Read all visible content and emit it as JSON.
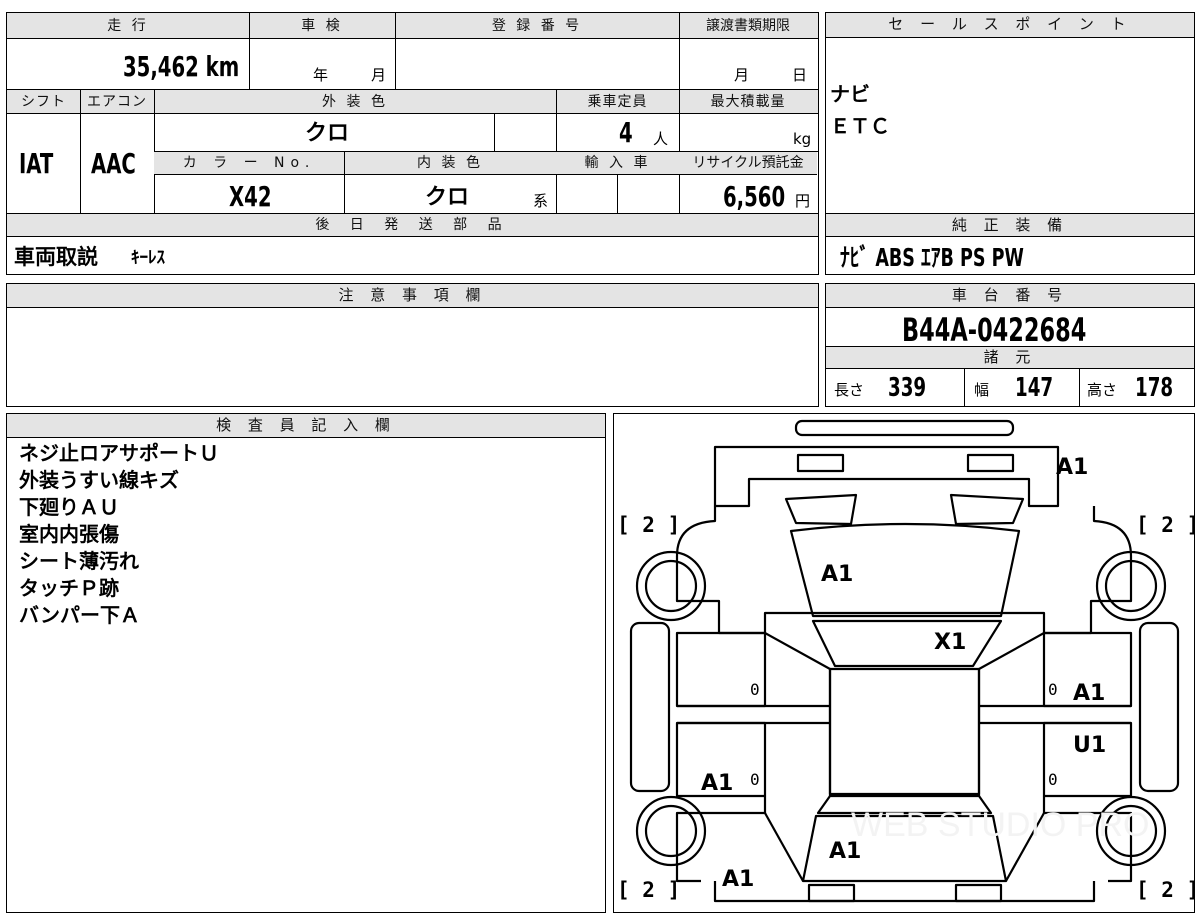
{
  "top_info": {
    "mileage_label": "走 行",
    "mileage": "35,462 km",
    "shaken_label": "車 検",
    "shaken_year": "年",
    "shaken_month": "月",
    "registration_label": "登 録 番 号",
    "transfer_deadline_label": "譲渡書類期限",
    "transfer_month": "月",
    "transfer_day": "日",
    "shift_label": "シフト",
    "shift": "IAT",
    "ac_label": "エアコン",
    "ac": "AAC",
    "exterior_color_label": "外 装 色",
    "exterior_color": "クロ",
    "capacity_label": "乗車定員",
    "capacity": "4",
    "capacity_unit": "人",
    "max_load_label": "最大積載量",
    "max_load_unit": "kg",
    "color_no_label": "カ ラ ー No.",
    "color_no": "X42",
    "interior_color_label": "内 装 色",
    "interior_color": "クロ",
    "interior_suffix": "系",
    "import_label": "輸 入 車",
    "recycle_label": "リサイクル預託金",
    "recycle_fee": "6,560",
    "recycle_unit": "円",
    "later_parts_label": "後 日 発 送 部 品",
    "later_parts_main": "車両取説",
    "later_parts_sub": "ｷｰﾚｽ"
  },
  "sales_points": {
    "label": "セ ー ル ス ポ イ ン ト",
    "items": [
      "ナビ",
      "ＥＴＣ"
    ]
  },
  "genuine_equipment": {
    "label": "純 正 装 備",
    "value": "ﾅﾋﾞ ABS ｴｱB PS PW"
  },
  "caution": {
    "label": "注 意 事 項 欄"
  },
  "chassis": {
    "label": "車 台 番 号",
    "number": "B44A-0422684",
    "spec_label": "諸 元",
    "length_label": "長さ",
    "length": "339",
    "width_label": "幅",
    "width": "147",
    "height_label": "高さ",
    "height": "178"
  },
  "inspector": {
    "label": "検 査 員 記 入 欄",
    "notes": [
      "ネジ止ロアサポートＵ",
      "外装うすい線キズ",
      "下廻りＡＵ",
      "室内内張傷",
      "シート薄汚れ",
      "タッチＰ跡",
      "バンパー下Ａ"
    ]
  },
  "diagram": {
    "marks": {
      "front_bumper": "A1",
      "hood": "A1",
      "roof_front": "X1",
      "right_front_door": "A1",
      "right_rear_door": "U1",
      "left_rear_door": "A1",
      "rear_gate": "A1",
      "left_rear_quarter": "A1"
    },
    "tire_tl": "[ 2 ]",
    "tire_tr": "[ 2 ]",
    "tire_bl": "[ 2 ]",
    "tire_br": "[ 2 ]",
    "zero_a": "0",
    "zero_b": "0",
    "zero_c": "0",
    "zero_d": "0",
    "watermark": "WEB STUDIO PRO"
  }
}
